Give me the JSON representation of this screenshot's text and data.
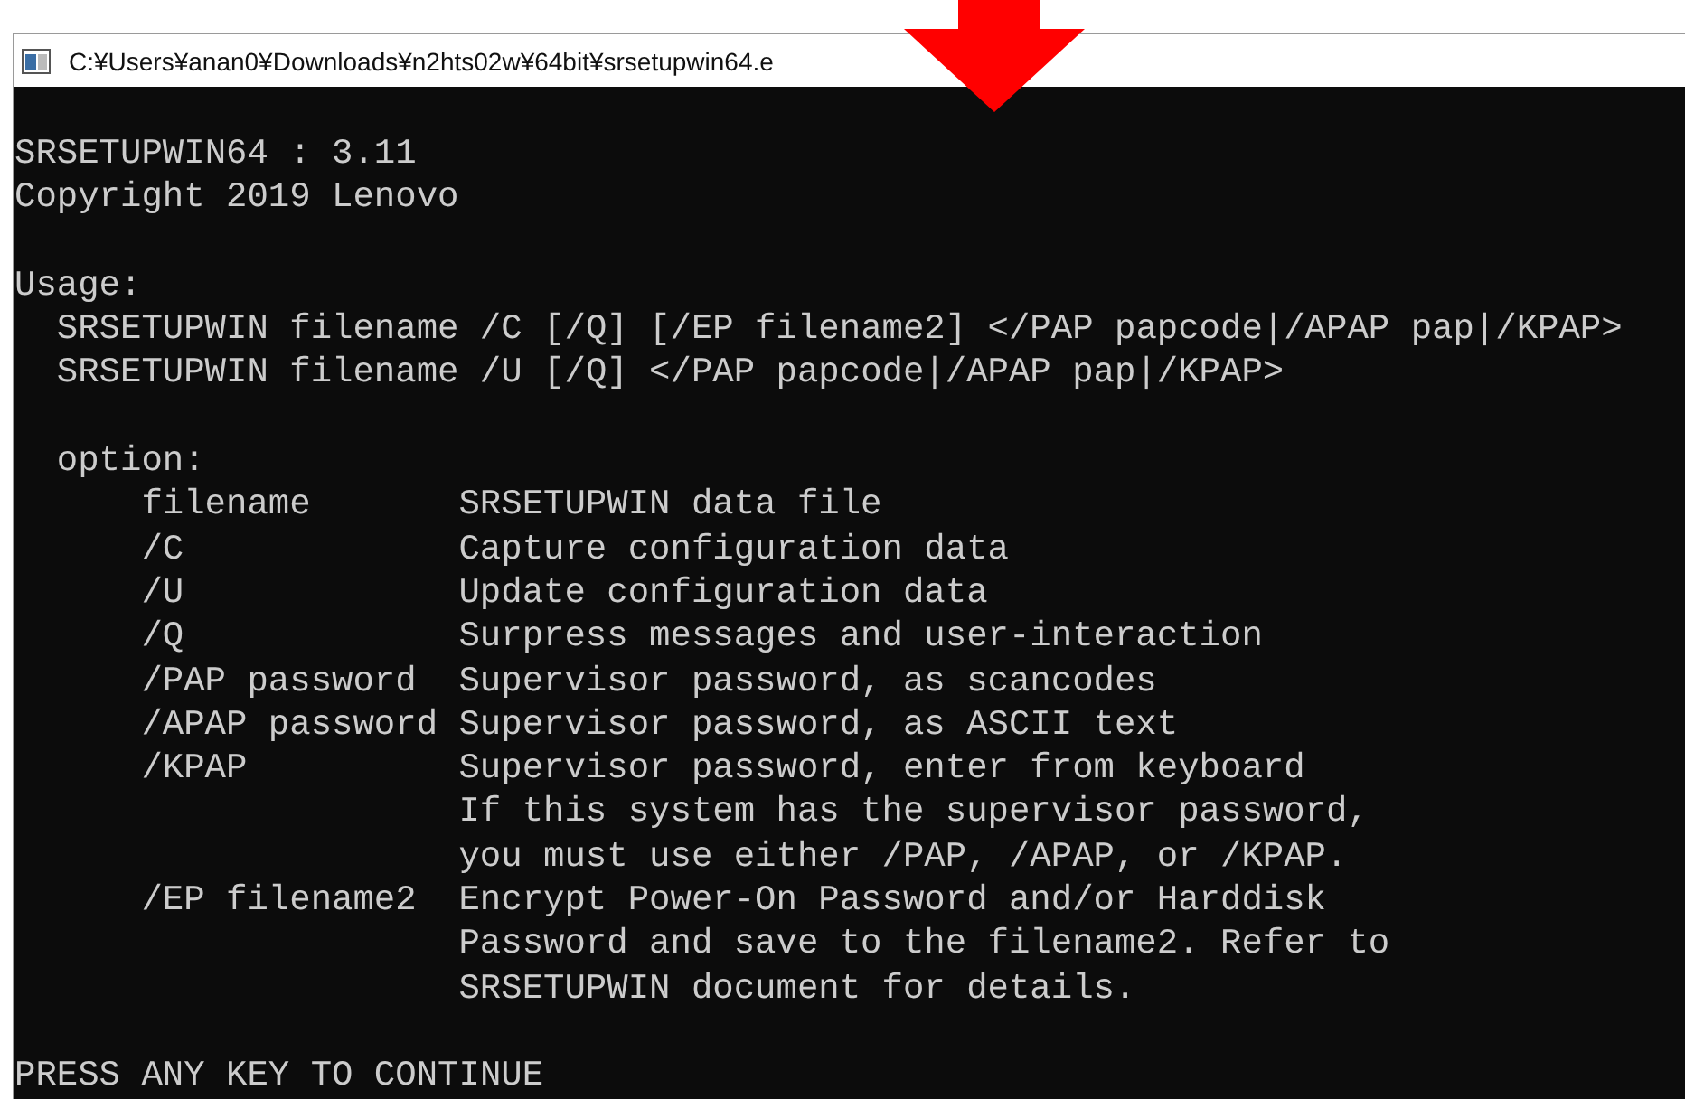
{
  "window": {
    "title": "C:¥Users¥anan0¥Downloads¥n2hts02w¥64bit¥srsetupwin64.e"
  },
  "console": {
    "header": [
      "SRSETUPWIN64 : 3.11",
      "Copyright 2019 Lenovo"
    ],
    "usage_label": "Usage:",
    "usage": [
      "SRSETUPWIN filename /C [/Q] [/EP filename2] </PAP papcode|/APAP pap|/KPAP>",
      "SRSETUPWIN filename /U [/Q] </PAP papcode|/APAP pap|/KPAP>"
    ],
    "option_label": "option:",
    "options": [
      {
        "name": "filename",
        "description": [
          "SRSETUPWIN data file"
        ]
      },
      {
        "name": "/C",
        "description": [
          "Capture configuration data"
        ]
      },
      {
        "name": "/U",
        "description": [
          "Update configuration data"
        ]
      },
      {
        "name": "/Q",
        "description": [
          "Surpress messages and user-interaction"
        ]
      },
      {
        "name": "/PAP password",
        "description": [
          "Supervisor password, as scancodes"
        ]
      },
      {
        "name": "/APAP password",
        "description": [
          "Supervisor password, as ASCII text"
        ]
      },
      {
        "name": "/KPAP",
        "description": [
          "Supervisor password, enter from keyboard",
          "If this system has the supervisor password,",
          "you must use either /PAP, /APAP, or /KPAP."
        ]
      },
      {
        "name": "/EP filename2",
        "description": [
          "Encrypt Power-On Password and/or Harddisk",
          "Password and save to the filename2. Refer to",
          "SRSETUPWIN document for details."
        ]
      }
    ],
    "prompt": "PRESS ANY KEY TO CONTINUE"
  }
}
